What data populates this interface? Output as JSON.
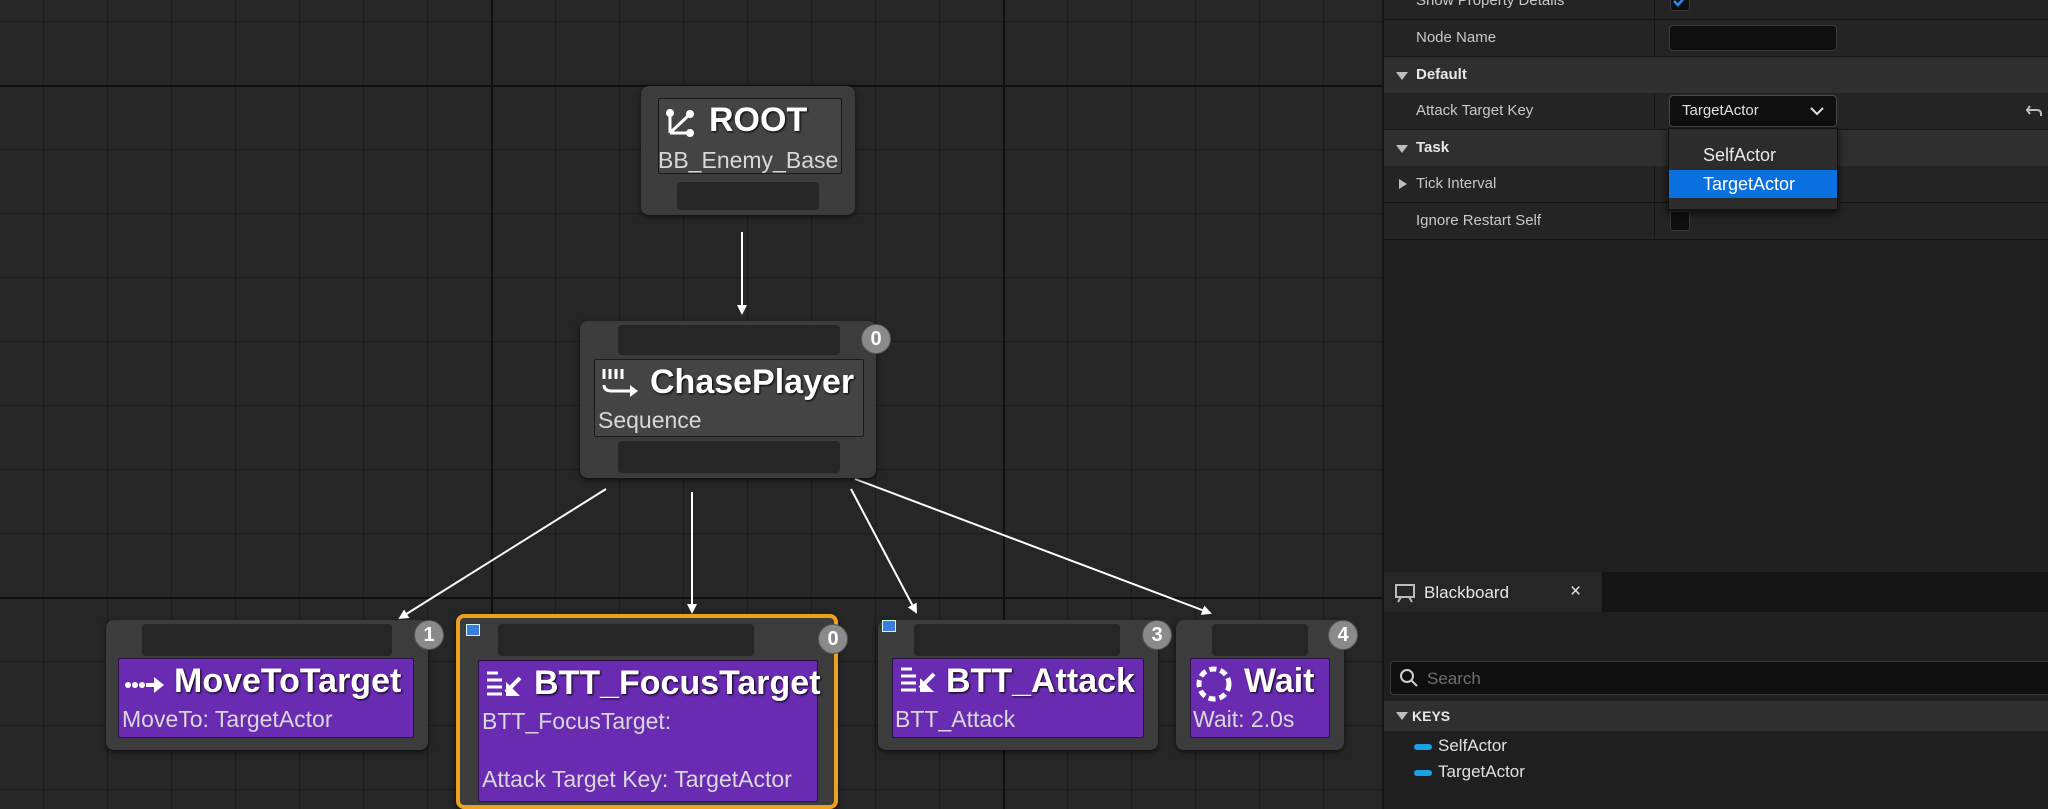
{
  "graph": {
    "root": {
      "title": "ROOT",
      "subtitle": "BB_Enemy_Base",
      "icon": "root-icon"
    },
    "sequence": {
      "title": "ChasePlayer",
      "subtitle": "Sequence",
      "index": "0",
      "icon": "sequence-icon"
    },
    "tasks": [
      {
        "title": "MoveToTarget",
        "subtitle": "MoveTo: TargetActor",
        "index": "1",
        "icon": "move-to-icon"
      },
      {
        "title": "BTT_FocusTarget",
        "subtitle": "BTT_FocusTarget:",
        "subtitle2": "Attack Target Key: TargetActor",
        "index": "0",
        "icon": "task-icon",
        "selected": true
      },
      {
        "title": "BTT_Attack",
        "subtitle": "BTT_Attack",
        "index": "3",
        "icon": "task-icon"
      },
      {
        "title": "Wait",
        "subtitle": "Wait: 2.0s",
        "index": "4",
        "icon": "wait-icon"
      }
    ]
  },
  "details": {
    "show_property_details_label": "Show Property Details",
    "show_property_details_checked": true,
    "node_name_label": "Node Name",
    "node_name_value": "",
    "default_category": "Default",
    "attack_target_key_label": "Attack Target Key",
    "attack_target_key_value": "TargetActor",
    "task_category": "Task",
    "tick_interval_label": "Tick Interval",
    "ignore_restart_self_label": "Ignore Restart Self",
    "dropdown_options": [
      "SelfActor",
      "TargetActor"
    ],
    "dropdown_selected": "TargetActor"
  },
  "blackboard": {
    "tab_label": "Blackboard",
    "close_label": "×",
    "search_placeholder": "Search",
    "keys_header": "KEYS",
    "keys": [
      "SelfActor",
      "TargetActor"
    ]
  },
  "colors": {
    "task_purple": "#6a2bb3",
    "selection_outline": "#f0a020",
    "dropdown_highlight": "#0a70e0",
    "key_pill": "#17a2e8"
  }
}
